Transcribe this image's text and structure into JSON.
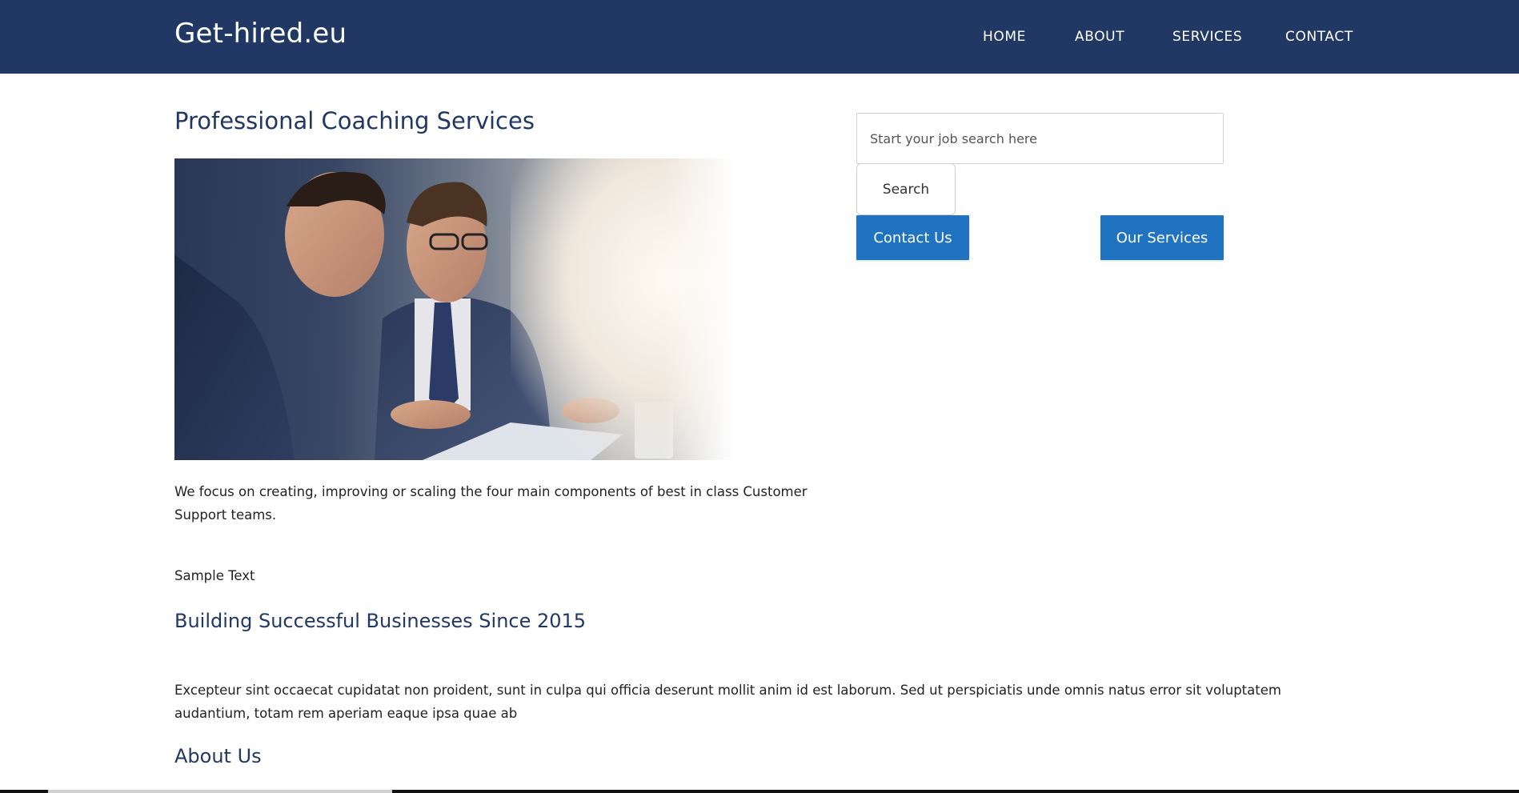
{
  "header": {
    "logo": "Get-hired.eu",
    "nav": [
      {
        "label": "HOME"
      },
      {
        "label": "ABOUT"
      },
      {
        "label": "SERVICES"
      },
      {
        "label": "CONTACT"
      }
    ]
  },
  "main": {
    "title": "Professional Coaching Services",
    "intro": "We focus on creating, improving or scaling the four main components of best in class Customer Support teams.",
    "sample_text": "Sample Text",
    "subtitle": "Building Successful Businesses Since 2015",
    "body": "Excepteur sint occaecat cupidatat non proident, sunt in culpa qui officia deserunt mollit anim id est laborum. Sed ut perspiciatis unde omnis natus error sit voluptatem audantium, totam rem aperiam eaque ipsa quae ab",
    "about_heading": "About Us"
  },
  "sidebar": {
    "search": {
      "placeholder": "Start your job search here",
      "value": "",
      "button_label": "Search"
    },
    "contact_button": "Contact Us",
    "services_button": "Our Services"
  },
  "colors": {
    "header_bg": "#213865",
    "heading": "#213865",
    "button_bg": "#1f73c1",
    "button_text": "#ffffff"
  }
}
